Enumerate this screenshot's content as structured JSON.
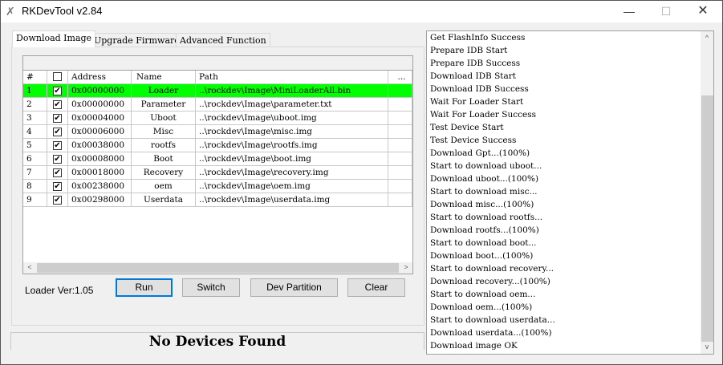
{
  "window": {
    "title": "RKDevTool v2.84",
    "icon": "tools-icon"
  },
  "tabs": [
    {
      "label": "Download Image",
      "active": true
    },
    {
      "label": "Upgrade Firmware"
    },
    {
      "label": "Advanced Function"
    }
  ],
  "table": {
    "columns": [
      "#",
      "",
      "Address",
      "Name",
      "Path",
      "..."
    ],
    "rows": [
      {
        "num": "1",
        "checked": true,
        "address": "0x00000000",
        "name": "Loader",
        "path": "..\\rockdev\\Image\\MiniLoaderAll.bin",
        "highlight": true
      },
      {
        "num": "2",
        "checked": true,
        "address": "0x00000000",
        "name": "Parameter",
        "path": "..\\rockdev\\Image\\parameter.txt"
      },
      {
        "num": "3",
        "checked": true,
        "address": "0x00004000",
        "name": "Uboot",
        "path": "..\\rockdev\\Image\\uboot.img"
      },
      {
        "num": "4",
        "checked": true,
        "address": "0x00006000",
        "name": "Misc",
        "path": "..\\rockdev\\Image\\misc.img"
      },
      {
        "num": "5",
        "checked": true,
        "address": "0x00038000",
        "name": "rootfs",
        "path": "..\\rockdev\\Image\\rootfs.img"
      },
      {
        "num": "6",
        "checked": true,
        "address": "0x00008000",
        "name": "Boot",
        "path": "..\\rockdev\\Image\\boot.img"
      },
      {
        "num": "7",
        "checked": true,
        "address": "0x00018000",
        "name": "Recovery",
        "path": "..\\rockdev\\Image\\recovery.img"
      },
      {
        "num": "8",
        "checked": true,
        "address": "0x00238000",
        "name": "oem",
        "path": "..\\rockdev\\Image\\oem.img"
      },
      {
        "num": "9",
        "checked": true,
        "address": "0x00298000",
        "name": "Userdata",
        "path": "..\\rockdev\\Image\\userdata.img"
      }
    ]
  },
  "loader_version": "Loader Ver:1.05",
  "buttons": {
    "run": "Run",
    "switch": "Switch",
    "dev_partition": "Dev Partition",
    "clear": "Clear"
  },
  "status": "No Devices Found",
  "log": [
    "Get FlashInfo Success",
    "Prepare IDB Start",
    "Prepare IDB Success",
    "Download IDB Start",
    "Download IDB Success",
    "Wait For Loader Start",
    "Wait For Loader Success",
    "Test Device Start",
    "Test Device Success",
    "Download Gpt...(100%)",
    "Start to download uboot...",
    "Download uboot...(100%)",
    "Start to download misc...",
    "Download misc...(100%)",
    "Start to download rootfs...",
    "Download rootfs...(100%)",
    "Start to download boot...",
    "Download boot...(100%)",
    "Start to download recovery...",
    "Download recovery...(100%)",
    "Start to download oem...",
    "Download oem...(100%)",
    "Start to download userdata...",
    "Download userdata...(100%)",
    "Download image OK"
  ],
  "colors": {
    "highlight_row": "#00ff00",
    "focus_border": "#0078d7"
  }
}
